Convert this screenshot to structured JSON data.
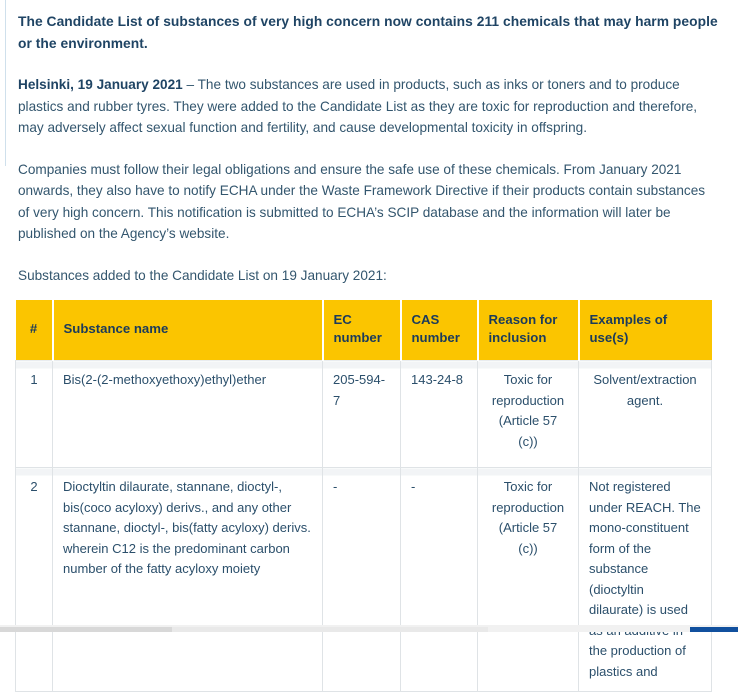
{
  "article": {
    "lede": "The Candidate List of substances of very high concern now contains 211 chemicals that may harm people or the environment.",
    "dateline": "Helsinki, 19 January 2021",
    "dateline_rest": " – The two substances are used in products, such as inks or toners and to produce plastics and rubber tyres. They were added to the Candidate List as they are toxic for reproduction and therefore, may adversely affect sexual function and fertility, and cause developmental toxicity in offspring.",
    "paragraph_2": "Companies must follow their legal obligations and ensure the safe use of these chemicals. From January 2021 onwards, they also have to notify ECHA under the Waste Framework Directive if their products contain substances of very high concern. This notification is submitted to ECHA’s SCIP database and the information will later be published on the Agency’s website.",
    "table_intro": "Substances added to the Candidate List on 19 January 2021:"
  },
  "table": {
    "headers": [
      "#",
      "Substance name",
      "EC number",
      "CAS number",
      "Reason for inclusion",
      "Examples of use(s)"
    ],
    "rows": [
      {
        "num": "1",
        "name": "Bis(2-(2-methoxyethoxy)ethyl)ether",
        "ec": "205-594-7",
        "cas": "143-24-8",
        "reason": "Toxic for reproduction (Article 57 (c))",
        "use": "Solvent/extraction agent."
      },
      {
        "num": "2",
        "name": "Dioctyltin dilaurate, stannane, dioctyl-, bis(coco acyloxy) derivs., and any other stannane, dioctyl-, bis(fatty acyloxy) derivs. wherein C12 is the predominant carbon number of the fatty acyloxy moiety",
        "ec": "-",
        "cas": "-",
        "reason": "Toxic for reproduction (Article 57 (c))",
        "use": "Not registered under REACH. The mono-constituent form of the substance (dioctyltin dilaurate) is used as an additive in the production of plastics and"
      }
    ]
  },
  "colors": {
    "header_background": "#fbc500",
    "header_text": "#1b3b5b",
    "body_text": "#33566e",
    "heading_text": "#1f4464",
    "cell_border": "#dfe3e6",
    "left_rule": "#cfe0ec",
    "accent_blue": "#11509e"
  }
}
